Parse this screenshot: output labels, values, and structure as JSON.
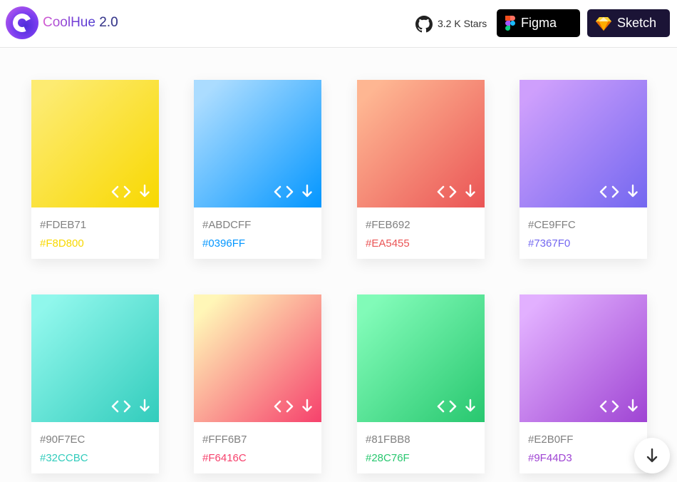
{
  "header": {
    "brand": "CoolHue",
    "version": "2.0",
    "stars": "3.2 K Stars",
    "figma_label": "Figma",
    "sketch_label": "Sketch"
  },
  "cards": [
    {
      "color1": "#FDEB71",
      "color2": "#F8D800"
    },
    {
      "color1": "#ABDCFF",
      "color2": "#0396FF"
    },
    {
      "color1": "#FEB692",
      "color2": "#EA5455"
    },
    {
      "color1": "#CE9FFC",
      "color2": "#7367F0"
    },
    {
      "color1": "#90F7EC",
      "color2": "#32CCBC"
    },
    {
      "color1": "#FFF6B7",
      "color2": "#F6416C"
    },
    {
      "color1": "#81FBB8",
      "color2": "#28C76F"
    },
    {
      "color1": "#E2B0FF",
      "color2": "#9F44D3"
    }
  ],
  "icons": {
    "logo": "coolhue-logo-icon",
    "github": "github-icon",
    "figma": "figma-icon",
    "sketch": "sketch-icon",
    "code": "code-icon",
    "download": "download-icon",
    "scroll": "arrow-down-icon"
  }
}
